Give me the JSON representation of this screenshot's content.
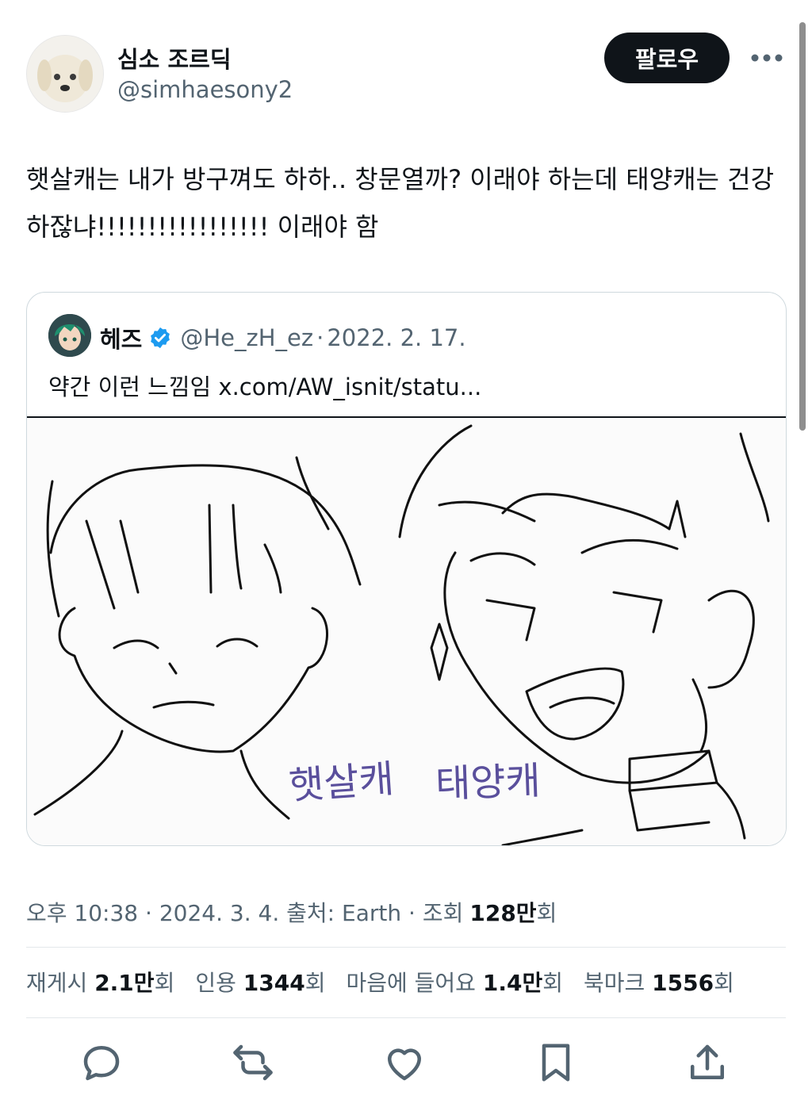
{
  "author": {
    "display_name": "심소 조르딕",
    "handle": "@simhaesony2"
  },
  "follow_label": "팔로우",
  "tweet_text": "햇살캐는 내가 방구껴도 하하.. 창문열까? 이래야 하는데 태양캐는 건강하잖냐!!!!!!!!!!!!!!!!! 이래야 함",
  "quote": {
    "name": "헤즈",
    "handle": "@He_zH_ez",
    "separator": "·",
    "date": "2022. 2. 17.",
    "text": "약간 이런 느낌임 x.com/AW_isnit/statu...",
    "drawing_labels": {
      "left": "햇살캐",
      "right": "태양캐"
    }
  },
  "meta": {
    "time": "오후 10:38",
    "sep1": "·",
    "date": "2024. 3. 4.",
    "source_label": "출처:",
    "source": "Earth",
    "sep2": "·",
    "views_label": "조회",
    "views_value": "128만",
    "views_suffix": "회"
  },
  "stats": {
    "reposts_label": "재게시",
    "reposts_value": "2.1만",
    "reposts_suffix": "회",
    "quotes_label": "인용",
    "quotes_value": "1344",
    "quotes_suffix": "회",
    "likes_label": "마음에 들어요",
    "likes_value": "1.4만",
    "likes_suffix": "회",
    "bookmarks_label": "북마크",
    "bookmarks_value": "1556",
    "bookmarks_suffix": "회"
  },
  "colors": {
    "text_primary": "#0f1419",
    "text_secondary": "#536471",
    "verified_blue": "#1d9bf0",
    "border": "#cfd9de",
    "follow_bg": "#0f1419",
    "handwriting": "#5a4f9c"
  },
  "icons": {
    "more": "more-horizontal-icon",
    "verified": "verified-badge-icon",
    "reply": "reply-icon",
    "repost": "repost-icon",
    "like": "heart-icon",
    "bookmark": "bookmark-icon",
    "share": "share-icon"
  }
}
